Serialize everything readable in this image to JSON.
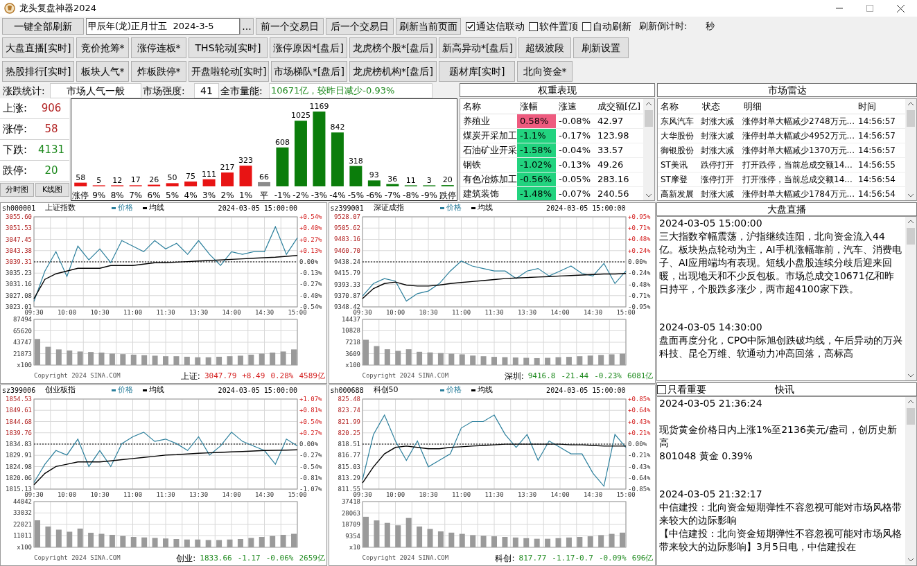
{
  "window": {
    "title": "龙头复盘神器2024"
  },
  "toolbar": {
    "refresh_all": "一键全部刷新",
    "date_value": "甲辰年(龙)正月廿五  2024-3-5",
    "picker": "...",
    "prev_day": "前一个交易日",
    "next_day": "后一个交易日",
    "refresh_page": "刷新当前页面",
    "checks": [
      {
        "label": "通达信联动",
        "checked": true
      },
      {
        "label": "软件置顶",
        "checked": false
      },
      {
        "label": "自动刷新",
        "checked": false
      }
    ],
    "countdown_label": "刷新倒计时:",
    "countdown_unit": "秒"
  },
  "nav_rows": [
    [
      "大盘直播[实时]",
      "竞价抢筹*",
      "涨停连板*",
      "THS轮动[实时]",
      "涨停原因*[盘后]",
      "龙虎榜个股*[盘后]",
      "新高异动*[盘后]",
      "超级波段",
      "刷新设置"
    ],
    [
      "热股排行[实时]",
      "板块人气*",
      "炸板跌停*",
      "开盘啦轮动[实时]",
      "市场梯队*[盘后]",
      "龙虎榜机构*[盘后]",
      "题材库[实时]",
      "北向资金*"
    ]
  ],
  "stats": {
    "label": "涨跌统计:",
    "mood": "市场人气一般",
    "strength_label": "市场强度:",
    "strength": "41",
    "volume_label": "全市量能:",
    "volume": "10671亿，较昨日减少-0.93%",
    "counts": [
      {
        "label": "上涨:",
        "value": "906",
        "color": "#b22222"
      },
      {
        "label": "涨停:",
        "value": "58",
        "color": "#b22222"
      },
      {
        "label": "下跌:",
        "value": "4131",
        "color": "#1f8a1f"
      },
      {
        "label": "跌停:",
        "value": "20",
        "color": "#1f8a1f"
      }
    ],
    "view_buttons": [
      "分时图",
      "K线图"
    ],
    "chart_data": {
      "type": "bar",
      "categories": [
        "涨停",
        "9%",
        "8%",
        "7%",
        "6%",
        "5%",
        "4%",
        "3%",
        "2%",
        "1%",
        "平",
        "-1%",
        "-2%",
        "-3%",
        "-4%",
        "-5%",
        "-6%",
        "-7%",
        "-8%",
        "-9%",
        "跌停"
      ],
      "stacked": true,
      "data_labels": true,
      "series": [
        {
          "color": "#e81414",
          "values": [
            58,
            5,
            12,
            17,
            26,
            50,
            75,
            111,
            217,
            323,
            null,
            null,
            null,
            null,
            null,
            null,
            null,
            null,
            null,
            null,
            null
          ]
        },
        {
          "color": "#8c8c8c",
          "values": [
            null,
            null,
            null,
            null,
            null,
            null,
            null,
            null,
            null,
            null,
            66,
            null,
            null,
            null,
            null,
            null,
            null,
            null,
            null,
            null,
            null
          ]
        },
        {
          "color": "#0b7d0b",
          "values": [
            null,
            null,
            null,
            null,
            null,
            null,
            null,
            null,
            null,
            null,
            null,
            608,
            1025,
            1169,
            842,
            318,
            93,
            36,
            11,
            3,
            20
          ]
        }
      ]
    }
  },
  "weights": {
    "title": "权重表现",
    "columns": [
      "名称",
      "涨幅",
      "涨速",
      "成交额[亿]"
    ],
    "rows": [
      {
        "name": "养殖业",
        "change": "0.58%",
        "speed": "-0.08%",
        "amount": "42.97",
        "color": "#ee5b7f"
      },
      {
        "name": "煤炭开采加工",
        "change": "-1.1%",
        "speed": "-0.17%",
        "amount": "123.98",
        "color": "#22d37f"
      },
      {
        "name": "石油矿业开采",
        "change": "-1.58%",
        "speed": "-0.04%",
        "amount": "33.57",
        "color": "#22d37f"
      },
      {
        "name": "钢铁",
        "change": "-1.02%",
        "speed": "-0.13%",
        "amount": "49.26",
        "color": "#22d37f"
      },
      {
        "name": "有色冶炼加工",
        "change": "-0.56%",
        "speed": "-0.05%",
        "amount": "283.16",
        "color": "#22d37f"
      },
      {
        "name": "建筑装饰",
        "change": "-1.48%",
        "speed": "-0.07%",
        "amount": "240.56",
        "color": "#22d37f"
      }
    ]
  },
  "radar": {
    "title": "市场雷达",
    "columns": [
      "名称",
      "状态",
      "明细",
      "时间"
    ],
    "rows": [
      {
        "name": "东风汽车",
        "status": "封涨大减",
        "detail": "涨停封单大幅减少2748万元...",
        "time": "14:56:57"
      },
      {
        "name": "大华股份",
        "status": "封涨大减",
        "detail": "涨停封单大幅减少4952万元...",
        "time": "14:56:57"
      },
      {
        "name": "御银股份",
        "status": "封涨大减",
        "detail": "涨停封单大幅减少1370万元...",
        "time": "14:56:57"
      },
      {
        "name": "ST美讯",
        "status": "跌停打开",
        "detail": "打开跌停，当前总成交额14...",
        "time": "14:56:55"
      },
      {
        "name": "ST摩登",
        "status": "涨停打开",
        "detail": "打开涨停，当前总成交额14...",
        "time": "14:56:54"
      },
      {
        "name": "高新发展",
        "status": "封涨大减",
        "detail": "涨停封单大幅减少1784万元...",
        "time": "14:56:54"
      }
    ]
  },
  "charts": [
    {
      "code": "sh000001",
      "name": "上证指数",
      "timestamp": "2024-03-05 15:00:00",
      "copyright": "Copyright 2024 SINA.COM",
      "quote": {
        "label": "上证:",
        "price": "3047.79",
        "change": "+8.49",
        "pct": "0.28%",
        "amount": "4589亿",
        "up": true
      },
      "price_chart": {
        "right_axis": [
          "+0.54%",
          "+0.40%",
          "+0.27%",
          "+0.13%",
          "0.00%",
          "-0.13%",
          "-0.27%",
          "-0.40%",
          "-0.54%"
        ],
        "chart_data": {
          "type": "line",
          "categories": [
            "09:30",
            null,
            null,
            "10:00",
            null,
            null,
            "10:30",
            null,
            null,
            "11:00",
            null,
            null,
            "11:30",
            null,
            null,
            "13:30",
            null,
            null,
            "14:00",
            null,
            null,
            "14:30",
            null,
            null,
            "15:00"
          ],
          "ylim": [
            3023.01,
            3055.6
          ],
          "grid": true,
          "ref_lines": [
            {
              "axis": "y",
              "value": 3039.31
            }
          ],
          "yticks": [
            {
              "value": 3055.6,
              "label": "3055.60"
            },
            3051.53,
            3047.45,
            3043.38,
            3039.31,
            3035.23,
            3031.16,
            3027.08,
            3023.01
          ],
          "series": [
            {
              "name": "价格",
              "color": "#2b7f9c",
              "values": [
                3025,
                3036,
                3043,
                3034,
                3045,
                3040,
                3044,
                3039,
                3047,
                3045,
                3043,
                3047,
                3044,
                3046,
                3042,
                3047,
                3042,
                3038,
                3043,
                3042,
                3043,
                3043,
                3052,
                3042,
                3048
              ]
            },
            {
              "name": "均线",
              "color": "#000000",
              "values": [
                3026,
                3033,
                3035,
                3036,
                3037,
                3037,
                3037,
                3038,
                3038,
                3038,
                3038.5,
                3039,
                3039,
                3039.2,
                3039.4,
                3039.6,
                3039.8,
                3040,
                3040.2,
                3040.4,
                3040.6,
                3040.8,
                3041,
                3041.3,
                3041.6
              ]
            }
          ]
        }
      },
      "volume_chart": {
        "chart_data": {
          "type": "bar",
          "ylim": [
            0,
            87494
          ],
          "grid": true,
          "yticks": [
            87494,
            65620,
            43747,
            21873
          ],
          "ylabel": "x100",
          "series": [
            {
              "color": "#9a9a9a",
              "values": [
                50000,
                35000,
                30000,
                28000,
                26000,
                25000,
                24000,
                22000,
                21000,
                20000,
                19000,
                18000,
                17000,
                17000,
                16000,
                15000,
                15000,
                16000,
                17000,
                18000,
                20000,
                22000,
                24000,
                26000,
                30000
              ]
            }
          ]
        }
      }
    },
    {
      "code": "sz399001",
      "name": "深证成指",
      "timestamp": "2024-03-05 15:00:00",
      "copyright": "Copyright 2024 SINA.COM",
      "quote": {
        "label": "深圳:",
        "price": "9416.8",
        "change": "-21.44",
        "pct": "-0.23%",
        "amount": "6081亿",
        "up": false
      },
      "price_chart": {
        "right_axis": [
          "+0.95%",
          "+0.71%",
          "+0.48%",
          "+0.24%",
          "0.00%",
          "-0.24%",
          "-0.48%",
          "-0.71%",
          "-0.95%"
        ],
        "chart_data": {
          "type": "line",
          "categories": [
            "09:30",
            null,
            null,
            "10:00",
            null,
            null,
            "10:30",
            null,
            null,
            "11:00",
            null,
            null,
            "11:30",
            null,
            null,
            "13:30",
            null,
            null,
            "14:00",
            null,
            null,
            "14:30",
            null,
            null,
            "15:00"
          ],
          "ylim": [
            9348.42,
            9528.07
          ],
          "grid": true,
          "ref_lines": [
            {
              "axis": "y",
              "value": 9438.24
            }
          ],
          "yticks": [
            9528.07,
            9505.62,
            9483.16,
            {
              "value": 9460.7,
              "label": "9460.70"
            },
            9438.24,
            9415.79,
            9393.33,
            9370.87,
            9348.42
          ],
          "series": [
            {
              "name": "价格",
              "color": "#2b7f9c",
              "values": [
                9370,
                9395,
                9405,
                9400,
                9360,
                9375,
                9380,
                9395,
                9420,
                9440,
                9430,
                9425,
                9420,
                9420,
                9405,
                9420,
                9425,
                9410,
                9420,
                9430,
                9415,
                9410,
                9435,
                9395,
                9420
              ]
            },
            {
              "name": "均线",
              "color": "#000000",
              "values": [
                9365,
                9385,
                9395,
                9398,
                9392,
                9390,
                9390,
                9392,
                9395,
                9397,
                9399,
                9401,
                9403,
                9405,
                9406,
                9407,
                9408,
                9409,
                9410,
                9411,
                9412,
                9413,
                9414,
                9414,
                9415
              ]
            }
          ]
        }
      },
      "volume_chart": {
        "chart_data": {
          "type": "bar",
          "ylim": [
            0,
            14437
          ],
          "grid": true,
          "yticks": [
            14437,
            10828,
            7218,
            3609
          ],
          "ylabel": "x100",
          "series": [
            {
              "color": "#9a9a9a",
              "values": [
                8000,
                6000,
                5000,
                4500,
                5000,
                4200,
                4000,
                3800,
                3600,
                3400,
                3000,
                2800,
                2600,
                2500,
                2400,
                2300,
                2200,
                2300,
                2500,
                2600,
                2800,
                3000,
                3200,
                3400,
                3600
              ]
            }
          ]
        }
      }
    },
    {
      "code": "sz399006",
      "name": "创业板指",
      "timestamp": "2024-03-05 15:00:00",
      "copyright": "Copyright 2024 SINA.COM",
      "quote": {
        "label": "创业:",
        "price": "1833.66",
        "change": "-1.17",
        "pct": "-0.06%",
        "amount": "2659亿",
        "up": false
      },
      "price_chart": {
        "right_axis": [
          "+1.07%",
          "+0.81%",
          "+0.54%",
          "+0.27%",
          "0.00%",
          "-0.27%",
          "-0.54%",
          "-0.81%",
          "-1.07%"
        ],
        "chart_data": {
          "type": "line",
          "categories": [
            "09:30",
            null,
            null,
            "10:00",
            null,
            null,
            "10:30",
            null,
            null,
            "11:00",
            null,
            null,
            "11:30",
            null,
            null,
            "13:30",
            null,
            null,
            "14:00",
            null,
            null,
            "14:30",
            null,
            null,
            "15:00"
          ],
          "ylim": [
            1815.13,
            1854.53
          ],
          "grid": true,
          "ref_lines": [
            {
              "axis": "y",
              "value": 1834.83
            }
          ],
          "yticks": [
            1854.53,
            1849.61,
            1844.68,
            1839.76,
            1834.83,
            1829.91,
            1824.98,
            1820.06,
            1815.13
          ],
          "series": [
            {
              "name": "价格",
              "color": "#2b7f9c",
              "values": [
                1818,
                1826,
                1832,
                1830,
                1837,
                1825,
                1832,
                1825,
                1835,
                1838,
                1840,
                1836,
                1837,
                1835,
                1832,
                1838,
                1830,
                1834,
                1840,
                1836,
                1834,
                1832,
                1826,
                1837,
                1834
              ]
            },
            {
              "name": "均线",
              "color": "#000000",
              "values": [
                1817,
                1822,
                1825,
                1826,
                1827,
                1827,
                1827,
                1827.5,
                1828,
                1828.5,
                1829,
                1829.5,
                1830,
                1830.2,
                1830.5,
                1830.8,
                1831,
                1831.2,
                1831.4,
                1831.6,
                1831.8,
                1832,
                1832.1,
                1832.2,
                1832.3
              ]
            }
          ]
        }
      },
      "volume_chart": {
        "chart_data": {
          "type": "bar",
          "ylim": [
            0,
            44042
          ],
          "grid": true,
          "yticks": [
            44042,
            33032,
            22021,
            11011
          ],
          "ylabel": "x100",
          "series": [
            {
              "color": "#9a9a9a",
              "values": [
                26000,
                20000,
                17000,
                15000,
                18000,
                14000,
                13000,
                12000,
                11000,
                10000,
                9500,
                9000,
                8500,
                8000,
                7500,
                7500,
                7000,
                7000,
                7500,
                8000,
                9000,
                10000,
                11000,
                12000,
                13000
              ]
            }
          ]
        }
      }
    },
    {
      "code": "sh000688",
      "name": "科创50",
      "timestamp": "2024-03-05 15:00:00",
      "copyright": "Copyright 2024 SINA.COM",
      "quote": {
        "label": "科创:",
        "price": "817.77",
        "change": "-1.17-0.7",
        "pct": "-0.09%",
        "amount": "696亿",
        "up": false
      },
      "price_chart": {
        "right_axis": [
          "+0.85%",
          "+0.64%",
          "+0.43%",
          "+0.21%",
          "0.00%",
          "-0.21%",
          "-0.43%",
          "-0.64%",
          "-0.85%"
        ],
        "chart_data": {
          "type": "line",
          "categories": [
            "09:30",
            null,
            null,
            "10:00",
            null,
            null,
            "10:30",
            null,
            null,
            "11:00",
            null,
            null,
            "11:30",
            null,
            null,
            "13:30",
            null,
            null,
            "14:00",
            null,
            null,
            "14:30",
            null,
            null,
            "15:00"
          ],
          "ylim": [
            811.55,
            825.48
          ],
          "grid": true,
          "ref_lines": [
            {
              "axis": "y",
              "value": 818.51
            }
          ],
          "yticks": [
            825.48,
            823.74,
            821.99,
            820.25,
            818.51,
            816.77,
            815.03,
            813.29,
            811.55
          ],
          "series": [
            {
              "name": "价格",
              "color": "#2b7f9c",
              "values": [
                813,
                820,
                823,
                819,
                816,
                819,
                815,
                816,
                817,
                821,
                822,
                822,
                823,
                820,
                818,
                820,
                816,
                819,
                818,
                817,
                817,
                814,
                812,
                820,
                818
              ]
            },
            {
              "name": "均线",
              "color": "#000000",
              "values": [
                812.5,
                815,
                817,
                818,
                818.2,
                818,
                817.8,
                817.8,
                818,
                818.1,
                818.2,
                818.3,
                818.4,
                818.5,
                818.5,
                818.5,
                818.5,
                818.5,
                818.5,
                818.4,
                818.4,
                818.3,
                818.2,
                818.2,
                818.2
              ]
            }
          ]
        }
      },
      "volume_chart": {
        "chart_data": {
          "type": "bar",
          "ylim": [
            0,
            37418
          ],
          "grid": true,
          "yticks": [
            37418,
            28063,
            18709,
            9354
          ],
          "ylabel": "x10",
          "series": [
            {
              "color": "#9a9a9a",
              "values": [
                25000,
                22000,
                20000,
                18000,
                24000,
                17000,
                15000,
                13000,
                12000,
                11000,
                10000,
                9500,
                9000,
                8500,
                8000,
                7500,
                7000,
                7000,
                7500,
                8000,
                8500,
                9000,
                10000,
                11000,
                12000
              ]
            }
          ]
        }
      }
    }
  ],
  "live": {
    "title": "大盘直播",
    "entries": [
      {
        "time": "2024-03-05 15:00:00",
        "text": "三大指数窄幅震荡，沪指继续连阳，北向资金流入44亿。板块热点轮动为主，AI手机涨幅靠前，汽车、消费电子、AI应用端均有表现。短线小盘股连续分歧后迎来回暖，出现地天和不少反包板。市场总成交10671亿和昨日持平，个股跌多涨少，两市超4100家下跌。"
      },
      {
        "time": "2024-03-05 14:30:00",
        "text": "盘面再度分化，CPO中际旭创跌破均线，午后异动的万兴科技、昆仑万维、软通动力冲高回落，高标高"
      }
    ]
  },
  "flash": {
    "important_only": {
      "label": "只看重要",
      "checked": false
    },
    "title": "快讯",
    "entries": [
      {
        "time": "2024-03-05 21:36:24",
        "spaced": true,
        "paragraphs": [
          "现货黄金价格日内上涨1%至2136美元/盎司，创历史新高",
          "801048 黄金 0.39%"
        ]
      },
      {
        "time": "2024-03-05 21:32:17",
        "spaced": false,
        "paragraphs": [
          "中信建投：北向资金短期弹性不容忽视可能对市场风格带来较大的边际影响",
          "【中信建投：北向资金短期弹性不容忽视可能对市场风格带来较大的边际影响】3月5日电，中信建投在"
        ]
      }
    ]
  }
}
